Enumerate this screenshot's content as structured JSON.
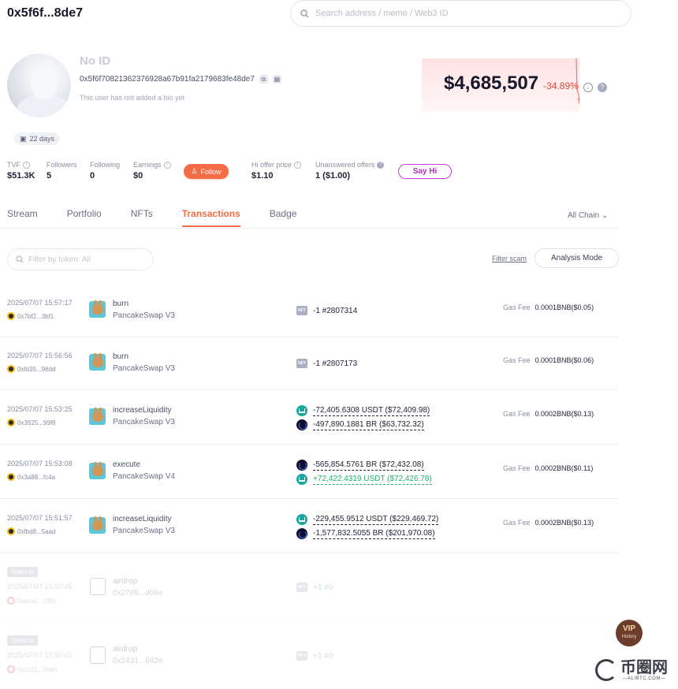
{
  "header": {
    "address_short": "0x5f6f...8de7",
    "search_placeholder": "Search address / memo / Web3 ID"
  },
  "profile": {
    "name": "No ID",
    "address_full": "0x5f6f70821362376928a67b91fa2179683fe48de7",
    "bio": "This user has not added a bio yet",
    "age_badge": "22 days",
    "total_value": "$4,685,507",
    "change_pct": "-34.89%"
  },
  "stats": {
    "tvf_label": "TVF",
    "tvf_value": "$51.3K",
    "followers_label": "Followers",
    "followers_value": "5",
    "following_label": "Following",
    "following_value": "0",
    "earnings_label": "Earnings",
    "earnings_value": "$0",
    "follow_button": "Follow",
    "hi_offer_label": "Hi offer price",
    "hi_offer_value": "$1.10",
    "unanswered_label": "Unanswered offers",
    "unanswered_value": "1 ($1.00)",
    "say_hi_button": "Say Hi"
  },
  "tabs": {
    "items": [
      "Stream",
      "Portfolio",
      "NFTs",
      "Transactions",
      "Badge"
    ],
    "active": "Transactions",
    "chain_filter": "All Chain"
  },
  "filters": {
    "token_placeholder": "Filter by token: All",
    "filter_scam": "Filter scam",
    "analysis_mode": "Analysis Mode"
  },
  "transactions": [
    {
      "time": "2025/07/07 15:57:17",
      "hash": "0x7bf2...3bf1",
      "method": "burn",
      "app": "PancakeSwap V3",
      "tokens": [
        {
          "type": "nft",
          "amount": "-1 #2807314"
        }
      ],
      "gas_label": "Gas Fee",
      "gas": "0.0001BNB($0.05)"
    },
    {
      "time": "2025/07/07 15:56:56",
      "hash": "0xfd35...96dd",
      "method": "burn",
      "app": "PancakeSwap V3",
      "tokens": [
        {
          "type": "nft",
          "amount": "-1 #2807173"
        }
      ],
      "gas_label": "Gas Fee",
      "gas": "0.0001BNB($0.06)"
    },
    {
      "time": "2025/07/07 15:53:25",
      "hash": "0x3925...99f8",
      "method": "increaseLiquidity",
      "app": "PancakeSwap V3",
      "tokens": [
        {
          "type": "usdt",
          "amount": "-72,405.6308 USDT ($72,409.98)"
        },
        {
          "type": "br",
          "amount": "-497,890.1881 BR ($63,732.32)"
        }
      ],
      "gas_label": "Gas Fee",
      "gas": "0.0002BNB($0.13)"
    },
    {
      "time": "2025/07/07 15:53:08",
      "hash": "0x3a88...fc4a",
      "method": "execute",
      "app": "PancakeSwap V4",
      "tokens": [
        {
          "type": "br",
          "amount": "-565,854.5761 BR ($72,432.08)"
        },
        {
          "type": "usdt",
          "amount": "+72,422.4319 USDT ($72,426.78)"
        }
      ],
      "gas_label": "Gas Fee",
      "gas": "0.0002BNB($0.11)"
    },
    {
      "time": "2025/07/07 15:51:57",
      "hash": "0xfbd8...5aad",
      "method": "increaseLiquidity",
      "app": "PancakeSwap V3",
      "tokens": [
        {
          "type": "usdt",
          "amount": "-229,455.9512 USDT ($229,469.72)"
        },
        {
          "type": "br",
          "amount": "-1,577,832.5055 BR ($201,970.08)"
        }
      ],
      "gas_label": "Gas Fee",
      "gas": "0.0002BNB($0.13)"
    }
  ],
  "scam_transactions": [
    {
      "tag": "Scam tx",
      "time": "2025/07/07 15:50:45",
      "hash": "0xeca1...33fd",
      "method": "airdrop",
      "contract": "0x27d9...d06e",
      "amount": "+1 #0"
    },
    {
      "tag": "Scam tx",
      "time": "2025/07/07 15:50:41",
      "hash": "0xcb21...3ae0",
      "method": "airdrop",
      "contract": "0x2431...662e",
      "amount": "+1 #0"
    }
  ],
  "vip": {
    "label": "VIP",
    "sub": "History"
  },
  "watermark": {
    "name": "币圈网",
    "domain": "—ALIBTC.COM—"
  }
}
